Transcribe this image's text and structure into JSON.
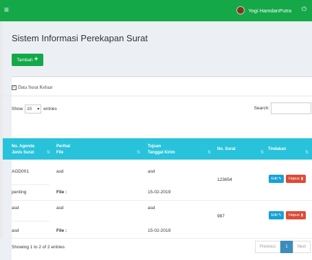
{
  "topbar": {
    "menu_icon": "hamburger-icon",
    "user_name": "Yogi HamdanPutra",
    "power_icon": "power-icon"
  },
  "page": {
    "title": "Sistem Informasi Perekapan Surat",
    "add_button_label": "Tambah"
  },
  "box": {
    "title": "Data Surat Keluar"
  },
  "table_controls": {
    "show_label": "Show",
    "entries_value": "10",
    "entries_label": "entries",
    "search_label": "Search:"
  },
  "table": {
    "headers": {
      "agenda_line1": "No. Agenda",
      "agenda_line2": "Jenis Surat",
      "perihal_line1": "Perihal",
      "perihal_line2": "File",
      "tujuan_line1": "Tujuan",
      "tujuan_line2": "Tanggal Kirim",
      "no_surat": "No. Surat",
      "tindakan": "Tindakan"
    },
    "rows": [
      {
        "agenda": "AGD001",
        "jenis": "penting",
        "perihal": "asd",
        "file": "File :",
        "tujuan": "asd",
        "tanggal": "15-02-2019",
        "no_surat": "123654",
        "edit": "Edit",
        "hapus": "Hapus"
      },
      {
        "agenda": "asd",
        "jenis": "asd",
        "perihal": "asd",
        "file": "File :",
        "tujuan": "asd",
        "tanggal": "15-02-2019",
        "no_surat": "987",
        "edit": "Edit",
        "hapus": "Hapus"
      }
    ]
  },
  "footer": {
    "info": "Showing 1 to 2 of 2 entries",
    "prev": "Previous",
    "page": "1",
    "next": "Next"
  },
  "colors": {
    "topbar": "#14a849",
    "table_header": "#28c3db",
    "edit": "#17a2d6",
    "delete": "#dd4b39"
  }
}
